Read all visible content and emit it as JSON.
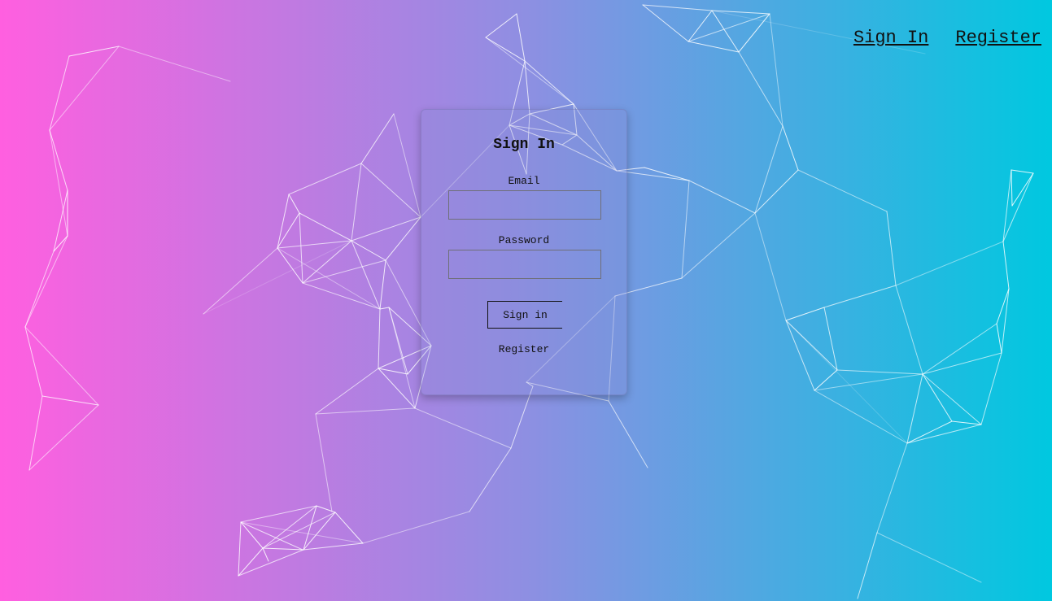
{
  "nav": {
    "signin_label": "Sign In",
    "register_label": "Register"
  },
  "signin_form": {
    "title": "Sign In",
    "email_label": "Email",
    "email_value": "",
    "password_label": "Password",
    "password_value": "",
    "submit_label": "Sign in",
    "register_link_label": "Register"
  },
  "colors": {
    "gradient_start": "#ff5fe0",
    "gradient_end": "#00c8e0",
    "network_lines": "#ffffff"
  }
}
